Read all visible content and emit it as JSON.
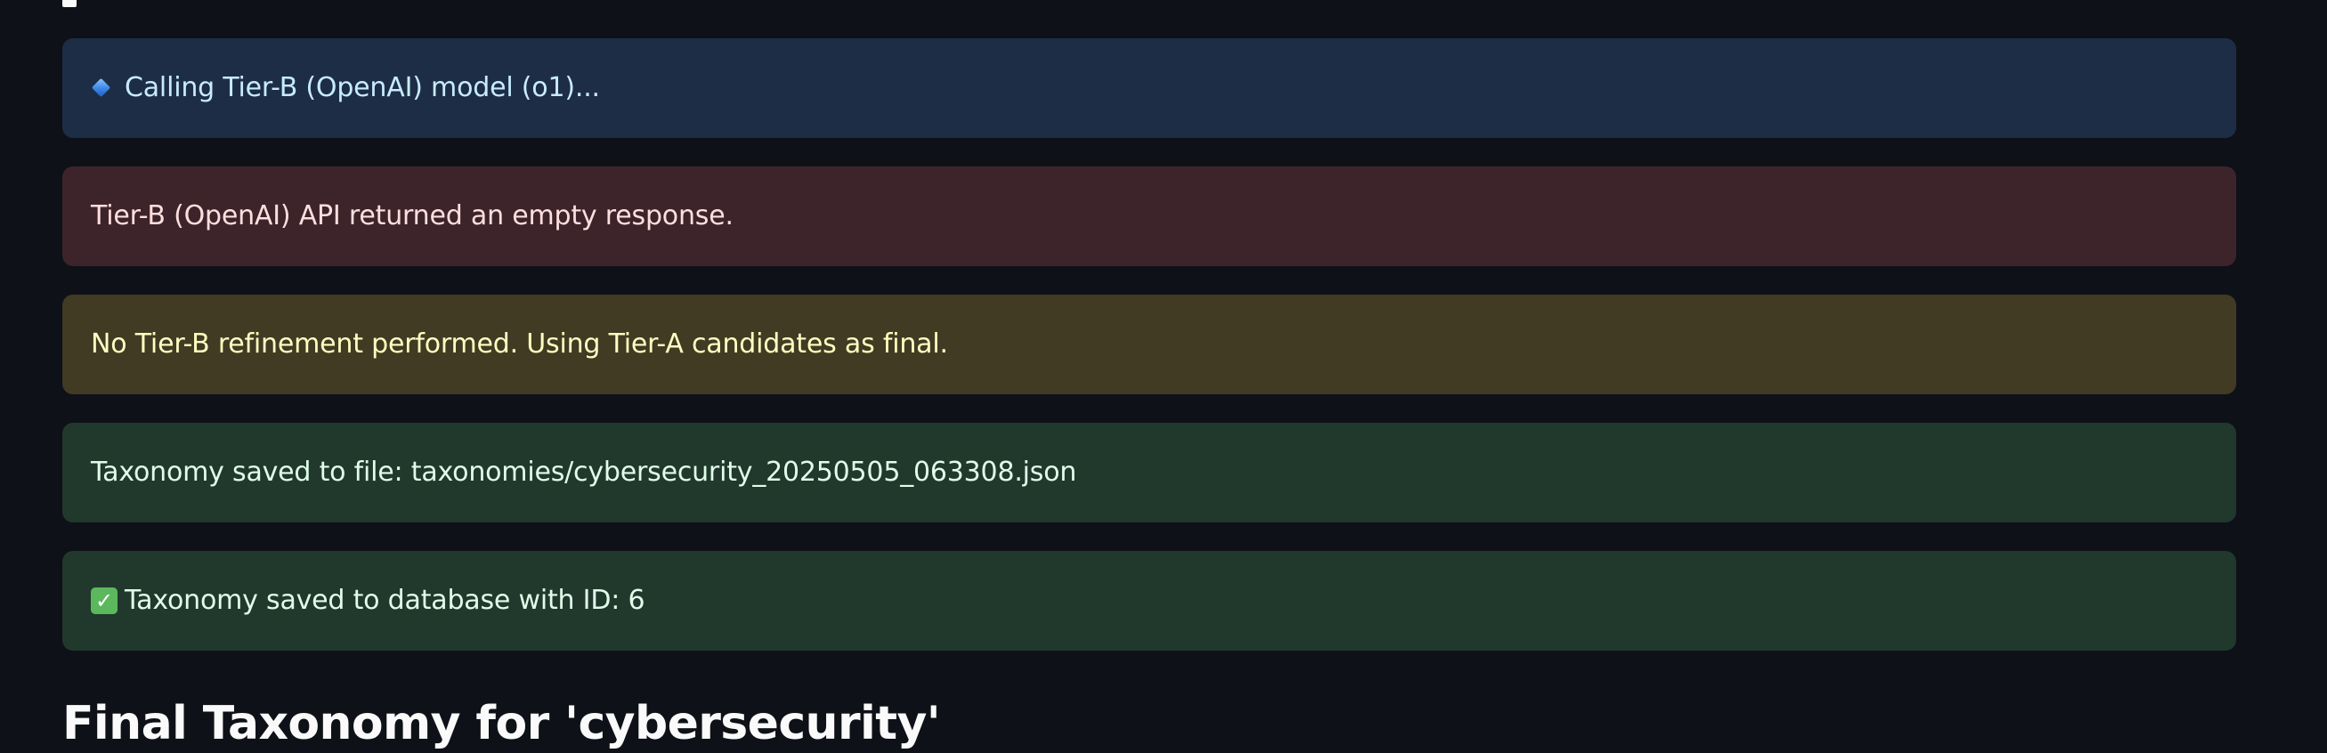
{
  "alerts": {
    "info": {
      "icon": "blue-diamond-icon",
      "text": "Calling Tier-B (OpenAI) model (o1)..."
    },
    "error": {
      "text": "Tier-B (OpenAI) API returned an empty response."
    },
    "warning": {
      "text": "No Tier-B refinement performed. Using Tier-A candidates as final."
    },
    "success_file": {
      "text": "Taxonomy saved to file: taxonomies/cybersecurity_20250505_063308.json"
    },
    "success_db": {
      "icon": "check-mark-icon",
      "icon_glyph": "✓",
      "text": "Taxonomy saved to database with ID: 6"
    }
  },
  "final_heading": "Final Taxonomy for 'cybersecurity'",
  "colors": {
    "background": "#0e1117",
    "info_bg": "#1e2d46",
    "error_bg": "#3d242a",
    "warning_bg": "#413b23",
    "success_bg": "#21382d"
  }
}
